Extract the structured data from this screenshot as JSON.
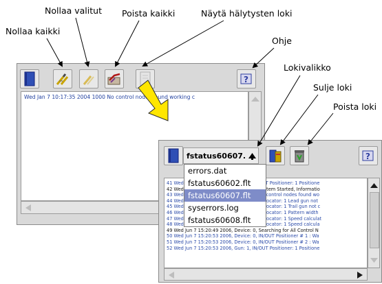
{
  "callouts": {
    "nollaa_valitut": "Nollaa valitut",
    "poista_kaikki": "Poista kaikki",
    "nayta_halytysten_loki": "Näytä hälytysten loki",
    "nollaa_kaikki": "Nollaa kaikki",
    "ohje": "Ohje",
    "lokivalikko": "Lokivalikko",
    "sulje_loki": "Sulje loki",
    "poista_loki": "Poista loki"
  },
  "window1": {
    "log_line": "Wed Jan  7 10:17:35 2004  1000   No control nodes found working c"
  },
  "window2": {
    "selected_file": "fstatus60607.",
    "dropdown_items": [
      "errors.dat",
      "fstatus60602.flt",
      "fstatus60607.flt",
      "syserrors.log",
      "fstatus60608.flt"
    ],
    "selected_index": 2,
    "log_rows": [
      {
        "text": "41 Wed Jun  7 15:20:47 2006, Gun: 1, IN/OUT Positioner: 1 Positione",
        "dark": false
      },
      {
        "text": "42 Wed Jun  7 15:20:47 2006, Device: 0, System Started, Informatio",
        "dark": true
      },
      {
        "text": "43 Wed Jun  7 15:20:47 2006, Device: 0, No control nodes found wo",
        "dark": false
      },
      {
        "text": "44 Wed Jun  7 15:20:47 2006, Gun: 1, Reciprocator: 1 Lead gun not",
        "dark": false
      },
      {
        "text": "45 Wed Jun  7 15:20:47 2006, Gun: 1, Reciprocator: 1 Trail gun not c",
        "dark": false
      },
      {
        "text": "46 Wed Jun  7 15:20:47 2006, Gun: 1, Reciprocator: 1 Pattern width",
        "dark": false
      },
      {
        "text": "47 Wed Jun  7 15:20:47 2006, Gun: 1, Reciprocator: 1 Speed calculat",
        "dark": false
      },
      {
        "text": "48 Wed Jun  7 15:20:47 2006, Gun: 1, Reciprocator: 1 Speed calcula",
        "dark": false
      },
      {
        "text": "49 Wed Jun  7 15:20:49 2006, Device: 0, Searching for All Control N",
        "dark": true
      },
      {
        "text": "50 Wed Jun  7 15:20:53 2006, Device: 0, IN/OUT Positioner # 1 : Wa",
        "dark": false
      },
      {
        "text": "51 Wed Jun  7 15:20:53 2006, Device: 0, IN/OUT Positioner # 2 : Wa",
        "dark": false
      },
      {
        "text": "52 Wed Jun  7 15:20:53 2006, Gun: 1, IN/OUT Positioner: 1 Positione",
        "dark": false
      }
    ]
  },
  "colors": {
    "window_bg": "#d9d9d9",
    "arrow_yellow": "#ffe600",
    "selection": "#7e8cc8",
    "log_text": "#2a4aa8"
  },
  "icons": {
    "book": "blue-book-icon",
    "reset_all": "reset-all-icon",
    "reset_selected": "reset-selected-icon",
    "delete_all": "delete-all-icon",
    "alarm_log": "alarm-log-icon",
    "help": "help-icon",
    "close_log": "close-log-icon",
    "delete_log": "recycle-bin-icon"
  }
}
